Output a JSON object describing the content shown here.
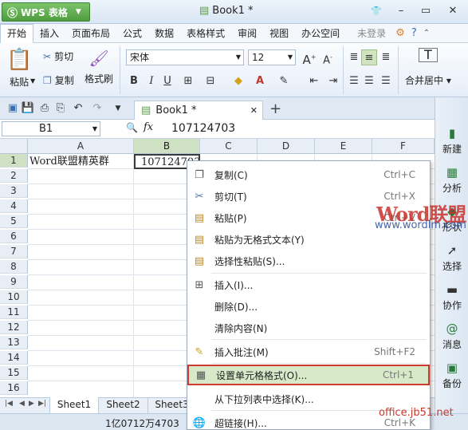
{
  "app": {
    "name": "WPS 表格",
    "doc_title": "Book1 *"
  },
  "window_controls": {
    "minimize": "–",
    "restore": "▭",
    "close": "✕",
    "skin": "👕"
  },
  "menu": {
    "tabs": [
      "开始",
      "插入",
      "页面布局",
      "公式",
      "数据",
      "表格样式",
      "审阅",
      "视图",
      "办公空间"
    ],
    "login": "未登录"
  },
  "ribbon": {
    "paste": "粘贴",
    "cut": "剪切",
    "copy": "复制",
    "format_painter": "格式刷",
    "font_name": "宋体",
    "font_size": "12",
    "bold": "B",
    "italic": "I",
    "underline": "U",
    "merge_center": "合并居中"
  },
  "tabbar": {
    "doc_tab": "Book1 *",
    "close": "✕",
    "add": "+"
  },
  "formula_bar": {
    "name_box": "B1",
    "fx": "fx",
    "value": "107124703"
  },
  "grid": {
    "columns": [
      "A",
      "B",
      "C",
      "D",
      "E",
      "F"
    ],
    "rows": [
      "1",
      "2",
      "3",
      "4",
      "5",
      "6",
      "7",
      "8",
      "9",
      "10",
      "11",
      "12",
      "13",
      "14",
      "15",
      "16"
    ],
    "a1": "Word联盟精英群",
    "b1": "107124703"
  },
  "sheets": {
    "tabs": [
      "Sheet1",
      "Sheet2",
      "Sheet3"
    ],
    "active": "Sheet1"
  },
  "status": {
    "sum_text": "1亿0712万4703"
  },
  "side_panel": {
    "items": [
      "新建",
      "分析",
      "形状",
      "选择",
      "协作",
      "消息",
      "备份"
    ]
  },
  "context_menu": {
    "items": [
      {
        "label": "复制(C)",
        "shortcut": "Ctrl+C"
      },
      {
        "label": "剪切(T)",
        "shortcut": "Ctrl+X"
      },
      {
        "label": "粘贴(P)",
        "shortcut": "Ctrl+V"
      },
      {
        "label": "粘贴为无格式文本(Y)",
        "shortcut": ""
      },
      {
        "label": "选择性粘贴(S)...",
        "shortcut": ""
      },
      {
        "label": "插入(I)...",
        "shortcut": ""
      },
      {
        "label": "删除(D)...",
        "shortcut": ""
      },
      {
        "label": "清除内容(N)",
        "shortcut": ""
      },
      {
        "label": "插入批注(M)",
        "shortcut": "Shift+F2"
      },
      {
        "label": "设置单元格格式(O)...",
        "shortcut": "Ctrl+1"
      },
      {
        "label": "从下拉列表中选择(K)...",
        "shortcut": ""
      },
      {
        "label": "超链接(H)...",
        "shortcut": "Ctrl+K"
      }
    ]
  },
  "watermarks": {
    "brand": "Word联盟",
    "url": "www.wordlm.com",
    "site": "office.jb51.net"
  }
}
